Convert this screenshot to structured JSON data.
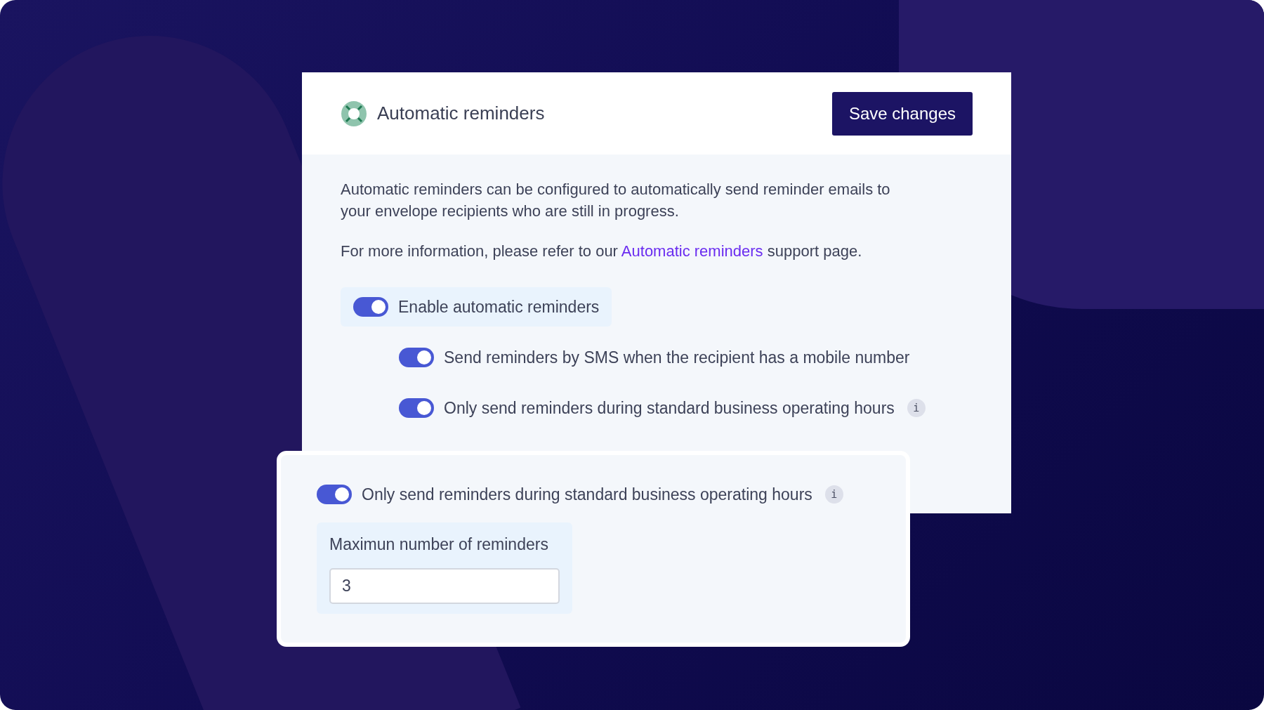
{
  "header": {
    "title": "Automatic reminders",
    "save_button": "Save changes"
  },
  "description": "Automatic reminders can be configured to automatically send reminder emails to your envelope recipients who are still in progress.",
  "more_info": {
    "before": "For more information, please refer to our ",
    "link": "Automatic reminders",
    "after": " support page."
  },
  "main_toggle": {
    "label": "Enable automatic reminders",
    "on": true
  },
  "sub_toggles": [
    {
      "label": "Send reminders by SMS when the recipient has a mobile number",
      "on": true
    },
    {
      "label": "Only send reminders during standard business operating hours",
      "on": true,
      "info": "i"
    }
  ],
  "detail_card": {
    "toggle": {
      "label": "Only send reminders during standard business operating hours",
      "on": true,
      "info": "i"
    },
    "field": {
      "label": "Maximun number of reminders",
      "value": "3"
    }
  }
}
